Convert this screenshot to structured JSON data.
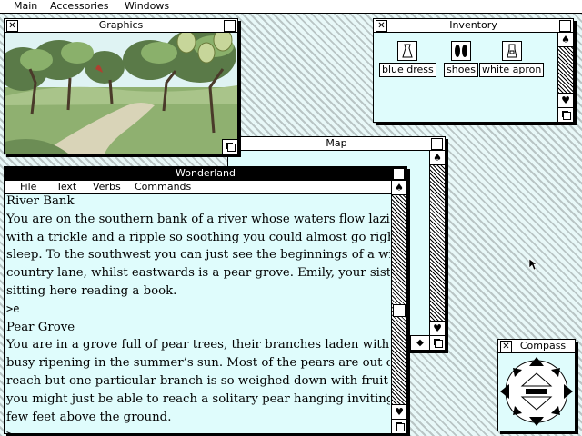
{
  "menubar": {
    "items": [
      "Main",
      "Accessories",
      "Windows"
    ]
  },
  "windows": {
    "graphics": {
      "title": "Graphics"
    },
    "inventory": {
      "title": "Inventory",
      "items": [
        "blue dress",
        "shoes",
        "white apron"
      ]
    },
    "map": {
      "title": "Map"
    },
    "wonderland": {
      "title": "Wonderland",
      "menu": [
        "File",
        "Text",
        "Verbs",
        "Commands"
      ],
      "text": {
        "heading1": "River Bank",
        "para1": [
          "You are on the southern bank of a river whose waters flow lazily by",
          "with a trickle and a ripple so soothing you could almost go right off to",
          "sleep. To the southwest you can just see the beginnings of a winding",
          "country lane, whilst eastwards is a pear grove. Emily, your sister, is",
          "sitting here reading a book."
        ],
        "command": ">e",
        "heading2": "Pear Grove",
        "para2": [
          "You are in a grove full of pear trees, their branches laden with fruit",
          "busy ripening in the summer’s sun. Most of the pears are out of your",
          "reach but one particular branch is so weighed down with fruit that",
          "you might just be able to reach a solitary pear hanging invitingly just a",
          "few feet above the ground."
        ],
        "prompt": ">"
      }
    },
    "compass": {
      "title": "Compass"
    }
  },
  "colors": {
    "window_bg": "#dffcfc",
    "foliage": "#7fa46a",
    "desk": "#e8f8f8"
  }
}
